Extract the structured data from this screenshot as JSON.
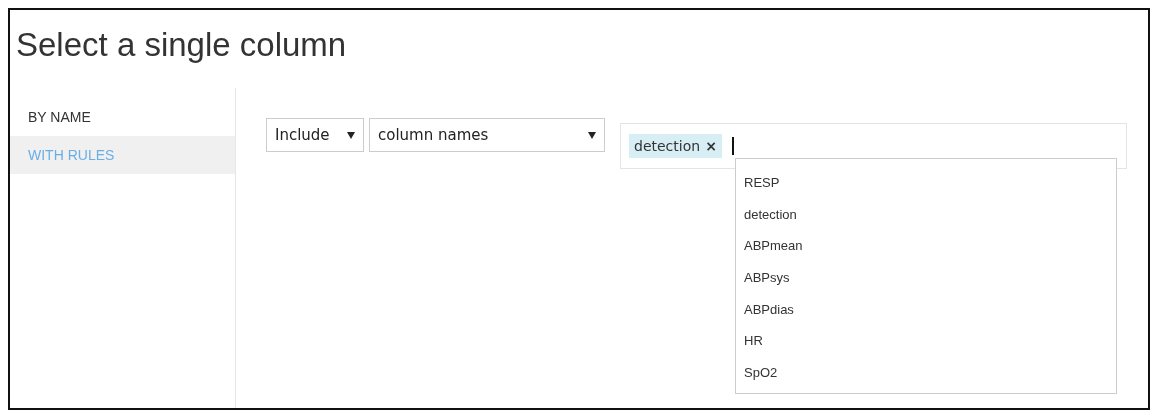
{
  "title": "Select a single column",
  "sidebar": {
    "items": [
      {
        "label": "BY NAME",
        "selected": false
      },
      {
        "label": "WITH RULES",
        "selected": true
      }
    ]
  },
  "rule": {
    "mode_dropdown": {
      "value": "Include"
    },
    "type_dropdown": {
      "value": "column names"
    },
    "token_field": {
      "tokens": [
        {
          "label": "detection",
          "remove": "×"
        }
      ],
      "focused": true
    },
    "suggestions": [
      "RESP",
      "detection",
      "ABPmean",
      "ABPsys",
      "ABPdias",
      "HR",
      "SpO2"
    ]
  }
}
